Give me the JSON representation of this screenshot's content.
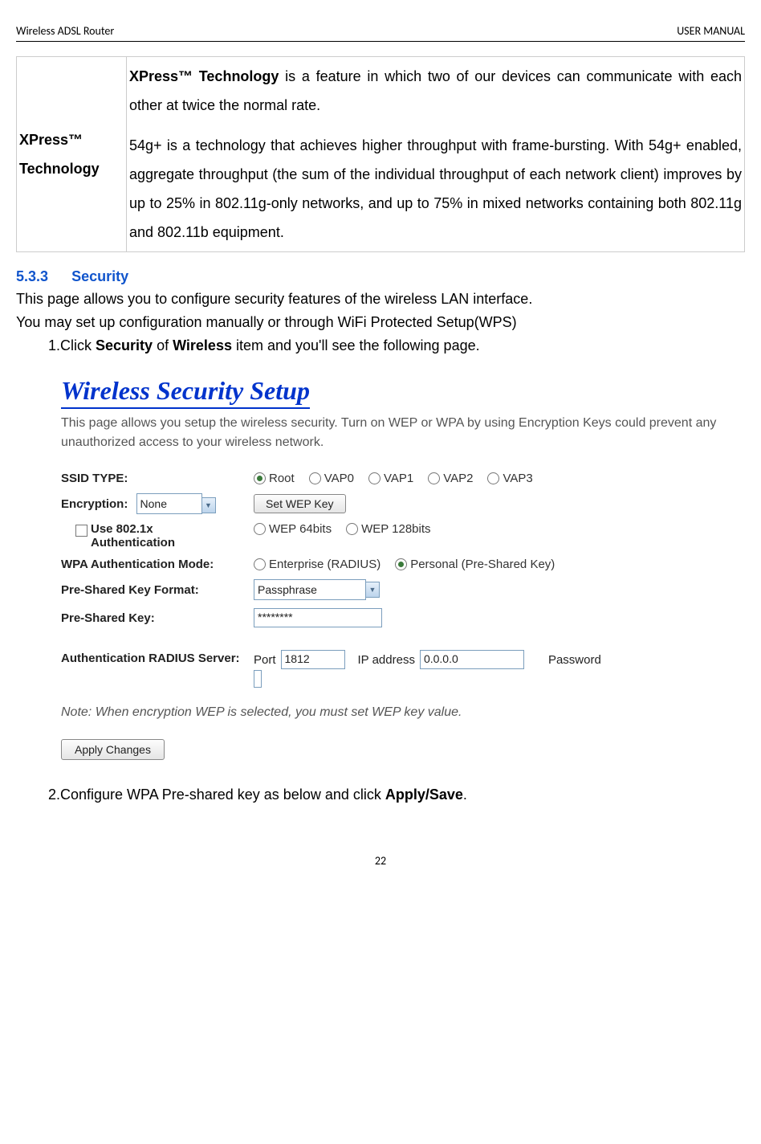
{
  "header": {
    "left": "Wireless ADSL Router",
    "right": "USER MANUAL"
  },
  "feature": {
    "label": "XPress™ Technology",
    "desc_bold": "XPress™ Technology",
    "desc_rest_1": " is a feature in which two of our devices can communicate with each other at twice the normal rate.",
    "desc_para2": "54g+ is a technology that achieves higher throughput with frame-bursting. With 54g+ enabled, aggregate throughput (the sum of the individual throughput of each network client) improves by up to 25% in 802.11g-only networks, and up to 75% in mixed networks containing both 802.11g and 802.11b equipment."
  },
  "section": {
    "number": "5.3.3",
    "title": "Security",
    "line1": "This page allows you to configure security features of the wireless LAN interface.",
    "line2": "You may set up configuration manually or through WiFi Protected Setup(WPS)",
    "step1_pre": "1.Click ",
    "step1_b1": "Security",
    "step1_mid": " of ",
    "step1_b2": "Wireless",
    "step1_post": " item and you'll see the following page.",
    "step2_pre": "2.Configure WPA Pre-shared key as below and click ",
    "step2_b": "Apply/Save",
    "step2_post": "."
  },
  "screenshot": {
    "title": "Wireless Security Setup",
    "subtext": "This page allows you setup the wireless security. Turn on WEP or WPA by using Encryption Keys could prevent any unauthorized access to your wireless network.",
    "ssid_label": "SSID TYPE:",
    "ssid_options": [
      "Root",
      "VAP0",
      "VAP1",
      "VAP2",
      "VAP3"
    ],
    "encryption_label": "Encryption:",
    "encryption_value": "None",
    "wep_button": "Set WEP Key",
    "use8021x": "Use 802.1x Authentication",
    "wep_opts": [
      "WEP 64bits",
      "WEP 128bits"
    ],
    "wpa_mode_label": "WPA Authentication Mode:",
    "wpa_mode_opts": [
      "Enterprise (RADIUS)",
      "Personal (Pre-Shared Key)"
    ],
    "psk_format_label": "Pre-Shared Key Format:",
    "psk_format_value": "Passphrase",
    "psk_label": "Pre-Shared Key:",
    "psk_value": "********",
    "radius_label": "Authentication RADIUS Server:",
    "radius_port_label": "Port",
    "radius_port_value": "1812",
    "radius_ip_label": "IP address",
    "radius_ip_value": "0.0.0.0",
    "radius_pw_label": "Password",
    "note": "Note: When encryption WEP is selected, you must set WEP key value.",
    "apply_btn": "Apply Changes"
  },
  "page_number": "22"
}
